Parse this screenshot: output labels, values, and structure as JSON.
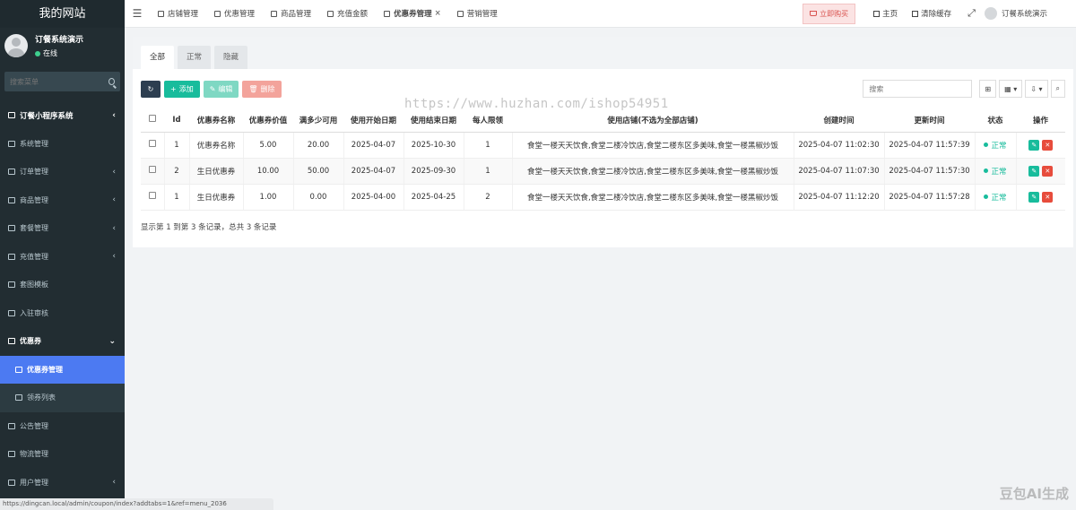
{
  "brand": "我的网站",
  "user": {
    "name": "订餐系统演示",
    "status": "在线"
  },
  "sidebar_search": {
    "placeholder": "搜索菜单"
  },
  "menu": [
    {
      "label": "订餐小程序系统",
      "type": "header",
      "chevron": "‹"
    },
    {
      "label": "系统管理",
      "chevron": ""
    },
    {
      "label": "订单管理",
      "chevron": "‹"
    },
    {
      "label": "商品管理",
      "chevron": "‹"
    },
    {
      "label": "套餐管理",
      "chevron": "‹"
    },
    {
      "label": "充值管理",
      "chevron": "‹"
    },
    {
      "label": "套图模板",
      "chevron": ""
    },
    {
      "label": "入驻审核",
      "chevron": ""
    },
    {
      "label": "优惠券",
      "type": "open",
      "chevron": "⌄"
    },
    {
      "label": "优惠券管理",
      "type": "active",
      "chevron": ""
    },
    {
      "label": "领券列表",
      "type": "sub",
      "chevron": ""
    },
    {
      "label": "公告管理",
      "chevron": ""
    },
    {
      "label": "物流管理",
      "chevron": ""
    },
    {
      "label": "用户管理",
      "chevron": "‹"
    }
  ],
  "status_url": "https://dingcan.local/admin/coupon/index?addtabs=1&ref=menu_2036",
  "topbar": {
    "tabs": [
      {
        "label": "店铺管理"
      },
      {
        "label": "优惠管理"
      },
      {
        "label": "商品管理"
      },
      {
        "label": "充值金额"
      },
      {
        "label": "优惠券管理",
        "active": true,
        "close": "×"
      },
      {
        "label": "营销管理"
      }
    ],
    "buy_label": "立即购买",
    "home_label": "主页",
    "clear_label": "清除缓存",
    "user_label": "订餐系统演示"
  },
  "subtabs": [
    "全部",
    "正常",
    "隐藏"
  ],
  "toolbar": {
    "add_label": "添加",
    "edit_label": "编辑",
    "delete_label": "删除",
    "search_placeholder": "搜索"
  },
  "table": {
    "headers": [
      "",
      "Id",
      "优惠券名称",
      "优惠券价值",
      "满多少可用",
      "使用开始日期",
      "使用结束日期",
      "每人限领",
      "使用店铺(不选为全部店铺)",
      "创建时间",
      "更新时间",
      "状态",
      "操作"
    ],
    "rows": [
      {
        "id": "1",
        "name": "优惠券名称",
        "value": "5.00",
        "min": "20.00",
        "start": "2025-04-07",
        "end": "2025-10-30",
        "limit": "1",
        "shops": "食堂一楼天天饮食,食堂二楼冷饮店,食堂二楼东区多美味,食堂一楼黑椒炒饭",
        "created": "2025-04-07 11:02:30",
        "updated": "2025-04-07 11:57:39",
        "status": "正常"
      },
      {
        "id": "2",
        "name": "生日优惠券",
        "value": "10.00",
        "min": "50.00",
        "start": "2025-04-07",
        "end": "2025-09-30",
        "limit": "1",
        "shops": "食堂一楼天天饮食,食堂二楼冷饮店,食堂二楼东区多美味,食堂一楼黑椒炒饭",
        "created": "2025-04-07 11:07:30",
        "updated": "2025-04-07 11:57:30",
        "status": "正常"
      },
      {
        "id": "1",
        "name": "生日优惠券",
        "value": "1.00",
        "min": "0.00",
        "start": "2025-04-00",
        "end": "2025-04-25",
        "limit": "2",
        "shops": "食堂一楼天天饮食,食堂二楼冷饮店,食堂二楼东区多美味,食堂一楼黑椒炒饭",
        "created": "2025-04-07 11:12:20",
        "updated": "2025-04-07 11:57:28",
        "status": "正常"
      }
    ]
  },
  "summary": "显示第 1 到第 3 条记录，总共 3 条记录",
  "watermark": "https://www.huzhan.com/ishop54951",
  "corner_mark": "豆包AI生成",
  "colors": {
    "sidebar": "#222d32",
    "active": "#4c7af2",
    "success": "#18bc9c",
    "danger": "#e74c3c"
  }
}
